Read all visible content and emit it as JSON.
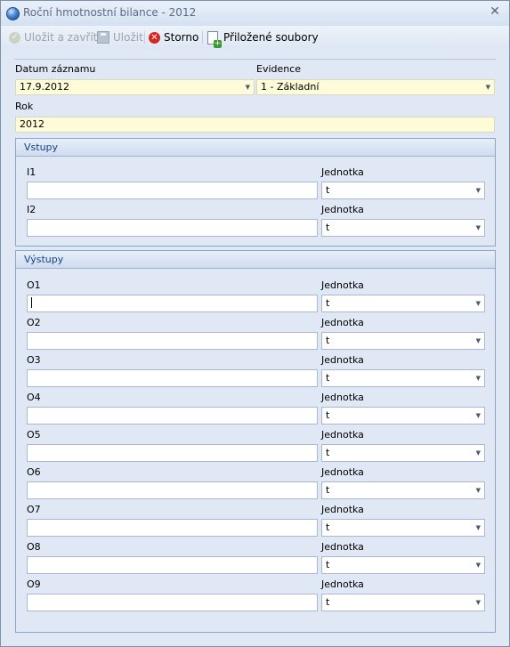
{
  "window": {
    "title": "Roční hmotnostní bilance - 2012"
  },
  "toolbar": {
    "save_close": "Uložit a zavřít",
    "save": "Uložit",
    "cancel": "Storno",
    "attachments": "Přiložené soubory"
  },
  "header": {
    "date_label": "Datum záznamu",
    "date_value": "17.9.2012",
    "evidence_label": "Evidence",
    "evidence_value": "1 - Základní",
    "year_label": "Rok",
    "year_value": "2012"
  },
  "inputs": {
    "title": "Vstupy",
    "rows": [
      {
        "label": "I1",
        "value": "",
        "unit_label": "Jednotka",
        "unit": "t"
      },
      {
        "label": "I2",
        "value": "",
        "unit_label": "Jednotka",
        "unit": "t"
      }
    ]
  },
  "outputs": {
    "title": "Výstupy",
    "rows": [
      {
        "label": "O1",
        "value": "",
        "unit_label": "Jednotka",
        "unit": "t"
      },
      {
        "label": "O2",
        "value": "",
        "unit_label": "Jednotka",
        "unit": "t"
      },
      {
        "label": "O3",
        "value": "",
        "unit_label": "Jednotka",
        "unit": "t"
      },
      {
        "label": "O4",
        "value": "",
        "unit_label": "Jednotka",
        "unit": "t"
      },
      {
        "label": "O5",
        "value": "",
        "unit_label": "Jednotka",
        "unit": "t"
      },
      {
        "label": "O6",
        "value": "",
        "unit_label": "Jednotka",
        "unit": "t"
      },
      {
        "label": "O7",
        "value": "",
        "unit_label": "Jednotka",
        "unit": "t"
      },
      {
        "label": "O8",
        "value": "",
        "unit_label": "Jednotka",
        "unit": "t"
      },
      {
        "label": "O9",
        "value": "",
        "unit_label": "Jednotka",
        "unit": "t"
      }
    ]
  }
}
